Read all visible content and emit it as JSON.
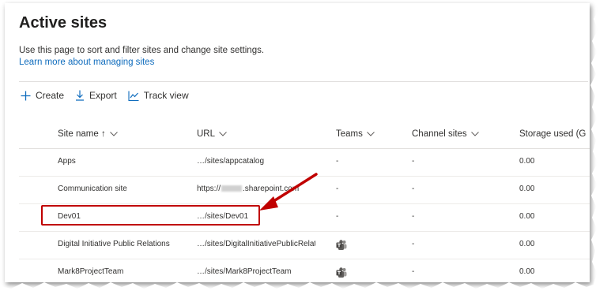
{
  "page": {
    "title": "Active sites",
    "description": "Use this page to sort and filter sites and change site settings.",
    "learn_link": "Learn more about managing sites"
  },
  "toolbar": {
    "create": "Create",
    "export": "Export",
    "track_view": "Track view"
  },
  "table": {
    "headers": {
      "site_name": "Site name ↑",
      "url": "URL",
      "teams": "Teams",
      "channel_sites": "Channel sites",
      "storage_used": "Storage used (G"
    },
    "rows": [
      {
        "name": "Apps",
        "url": "…/sites/appcatalog",
        "teams": "-",
        "channel": "-",
        "storage": "0.00"
      },
      {
        "name": "Communication site",
        "url_prefix": "https://",
        "url_suffix": ".sharepoint.com",
        "teams": "-",
        "channel": "-",
        "storage": "0.00"
      },
      {
        "name": "Dev01",
        "url": "…/sites/Dev01",
        "teams": "-",
        "channel": "-",
        "storage": "0.00"
      },
      {
        "name": "Digital Initiative Public Relations",
        "url": "…/sites/DigitalInitiativePublicRelatio…",
        "teams": "",
        "channel": "-",
        "storage": "0.00"
      },
      {
        "name": "Mark8ProjectTeam",
        "url": "…/sites/Mark8ProjectTeam",
        "teams": "",
        "channel": "-",
        "storage": "0.00"
      }
    ]
  },
  "colors": {
    "accent": "#0f6cbd",
    "highlight": "#c00000"
  }
}
